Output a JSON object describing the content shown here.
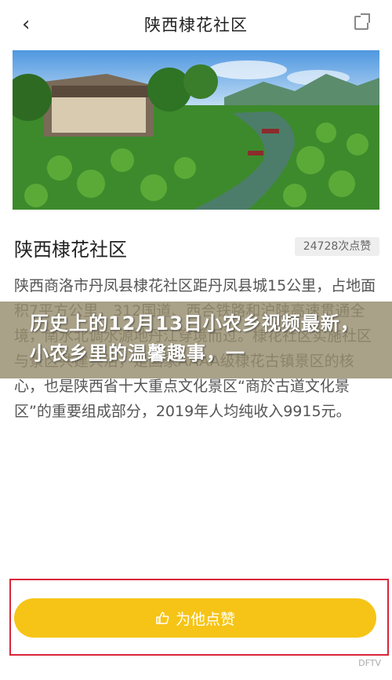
{
  "header": {
    "back_glyph": "‹",
    "title": "陕西棣花社区",
    "share_icon": "share-icon"
  },
  "hero": {
    "description": "lotus pond scenery"
  },
  "info": {
    "title": "陕西棣花社区",
    "views": "24728次点赞",
    "description": "陕西商洛市丹凤县棣花社区距丹凤县城15公里，占地面积7平方公里，312国道、西合铁路和沪陕高速贯通全境，南水北调水源地丹江穿境而过。棣花社区实施社区与景区共建共治，是国家AAAA级棣花古镇景区的核心，也是陕西省十大重点文化景区“商於古道文化景区”的重要组成部分，2019年人均纯收入9915元。"
  },
  "banner": {
    "text": "历史上的12月13日小农乡视频最新，小农乡里的温馨趣事，一"
  },
  "like_button": {
    "label": "为他点赞"
  },
  "watermark": {
    "text": "DFTV"
  },
  "colors": {
    "accent": "#f6c416",
    "highlight": "#d9253a"
  }
}
